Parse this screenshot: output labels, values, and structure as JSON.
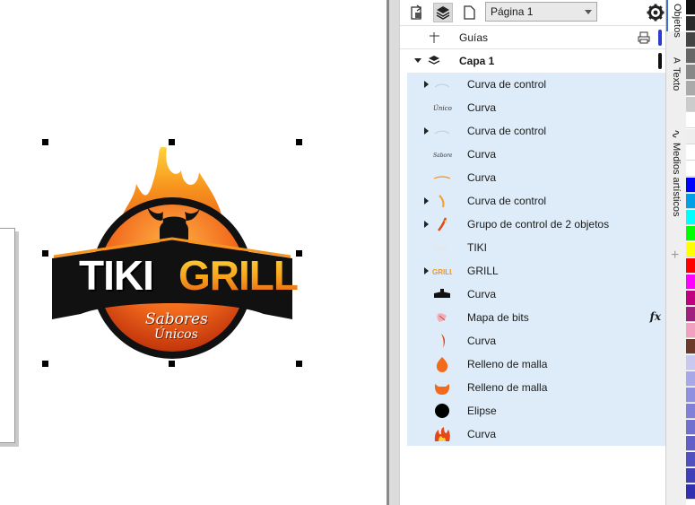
{
  "canvas": {
    "logo": {
      "word_tiki": "TIKI",
      "word_grill": "GRILL",
      "word_sabores": "Sabores",
      "word_unicos": "Únicos"
    }
  },
  "toolbar": {
    "page_select_value": "Página 1",
    "icons": [
      "page-properties-icon",
      "layers-icon",
      "page-icon",
      "gear-icon"
    ]
  },
  "panel": {
    "guides_label": "Guías",
    "layer_label": "Capa 1",
    "objects": [
      {
        "label": "Curva de control",
        "expandable": true,
        "thumb": "control-curve-thumb"
      },
      {
        "label": "Curva",
        "expandable": false,
        "thumb": "unicos-text-thumb"
      },
      {
        "label": "Curva de control",
        "expandable": true,
        "thumb": "control-curve-thumb"
      },
      {
        "label": "Curva",
        "expandable": false,
        "thumb": "sabores-text-thumb"
      },
      {
        "label": "Curva",
        "expandable": false,
        "thumb": "orange-arc-thumb"
      },
      {
        "label": "Curva de control",
        "expandable": true,
        "thumb": "flame-stroke-thumb"
      },
      {
        "label": "Grupo de control de 2 objetos",
        "expandable": true,
        "thumb": "flame-group-thumb"
      },
      {
        "label": "TIKI",
        "expandable": false,
        "thumb": "tiki-text-thumb"
      },
      {
        "label": "GRILL",
        "expandable": true,
        "thumb": "grill-text-thumb"
      },
      {
        "label": "Curva",
        "expandable": false,
        "thumb": "banner-thumb"
      },
      {
        "label": "Mapa de bits",
        "expandable": false,
        "thumb": "bitmap-thumb",
        "effect": "fx"
      },
      {
        "label": "Curva",
        "expandable": false,
        "thumb": "flame-curve-thumb"
      },
      {
        "label": "Relleno de malla",
        "expandable": false,
        "thumb": "mesh-fill-thumb"
      },
      {
        "label": "Relleno de malla",
        "expandable": false,
        "thumb": "mesh-fill-bowl-thumb"
      },
      {
        "label": "Elipse",
        "expandable": false,
        "thumb": "ellipse-thumb"
      },
      {
        "label": "Curva",
        "expandable": false,
        "thumb": "fire-thumb"
      }
    ]
  },
  "docker_tabs": {
    "objects": "Objetos",
    "text": "Texto",
    "artistic_media": "Medios artísticos",
    "add": "+"
  },
  "palette": {
    "colors": [
      "#111111",
      "#2a2a2a",
      "#444444",
      "#666666",
      "#888888",
      "#aaaaaa",
      "#cccccc",
      "#ffffff",
      "#eeeeee",
      "#ffffff",
      "#ffffff",
      "#0000ff",
      "#00a0e6",
      "#00ffff",
      "#00ff00",
      "#ffff00",
      "#ff0000",
      "#ff00ff",
      "#c00080",
      "#a02080",
      "#f3a0c0",
      "#6b3a2a",
      "#c8c8f0",
      "#a8a8e8",
      "#9090e0",
      "#8080d8",
      "#7070d0",
      "#6060c8",
      "#5050c0",
      "#4040b8",
      "#3030b0"
    ]
  }
}
